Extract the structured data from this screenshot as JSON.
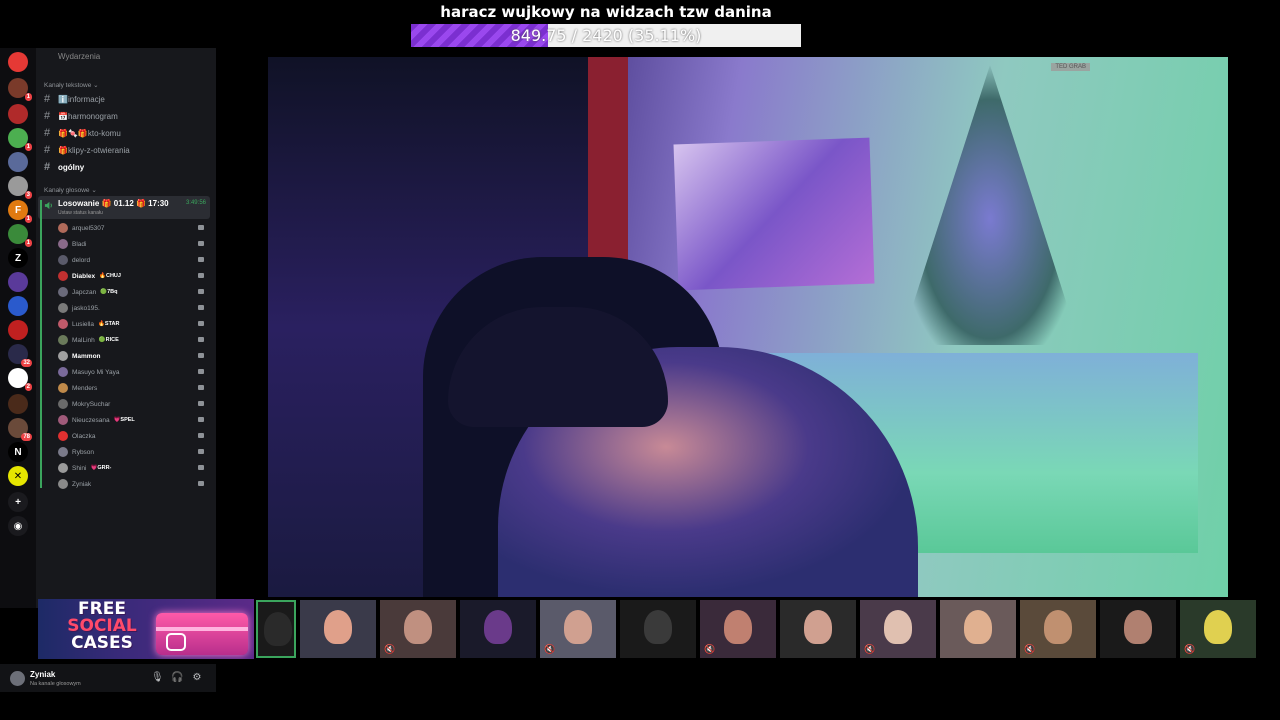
{
  "goal": {
    "title": "haracz wujkowy na widzach tzw danina",
    "progress_text": "849.75 / 2420 (35.11%)",
    "fraction": 0.3511
  },
  "rail": [
    {
      "name": "server-pokeball-icon",
      "color": "#e53935",
      "glyph": "",
      "badge": ""
    },
    {
      "name": "server-icon",
      "color": "#7a3a2a",
      "glyph": "",
      "badge": "1"
    },
    {
      "name": "server-icon",
      "color": "#b02a2a",
      "glyph": "",
      "badge": ""
    },
    {
      "name": "server-icon",
      "color": "#4caf50",
      "glyph": "",
      "badge": "1"
    },
    {
      "name": "server-icon",
      "color": "#5a6a9a",
      "glyph": "",
      "badge": ""
    },
    {
      "name": "server-icon",
      "color": "#9a9a9a",
      "glyph": "",
      "badge": "3"
    },
    {
      "name": "server-icon",
      "color": "#e07a10",
      "glyph": "F",
      "badge": "1"
    },
    {
      "name": "server-icon",
      "color": "#3a8a3a",
      "glyph": "",
      "badge": "1"
    },
    {
      "name": "server-icon",
      "color": "#000000",
      "glyph": "Z",
      "badge": ""
    },
    {
      "name": "server-icon",
      "color": "#5a3a9a",
      "glyph": "",
      "badge": ""
    },
    {
      "name": "server-icon",
      "color": "#2a5acc",
      "glyph": "",
      "badge": ""
    },
    {
      "name": "server-icon",
      "color": "#c02020",
      "glyph": "",
      "badge": ""
    },
    {
      "name": "server-icon",
      "color": "#2a2a4a",
      "glyph": "",
      "badge": "32"
    },
    {
      "name": "server-icon",
      "color": "#ffffff",
      "glyph": "",
      "badge": "2"
    },
    {
      "name": "server-icon",
      "color": "#4a2a1a",
      "glyph": "",
      "badge": ""
    },
    {
      "name": "server-icon",
      "color": "#6a4a3a",
      "glyph": "",
      "badge": "78"
    },
    {
      "name": "server-icon",
      "color": "#000000",
      "glyph": "N",
      "badge": ""
    },
    {
      "name": "server-icon",
      "color": "#e5e500",
      "glyph": "✕",
      "badge": ""
    },
    {
      "name": "add-server-icon",
      "color": "#1a1a1e",
      "glyph": "+",
      "badge": ""
    },
    {
      "name": "explore-icon",
      "color": "#1a1a1e",
      "glyph": "◉",
      "badge": ""
    }
  ],
  "sidebar": {
    "events_label": "Wydarzenia",
    "text_category": "Kanały tekstowe",
    "text_channels": [
      {
        "label": "ℹ️informacje",
        "bold": false
      },
      {
        "label": "📅harmonogram",
        "bold": false
      },
      {
        "label": "🎁🍬🎁kto-komu",
        "bold": false
      },
      {
        "label": "🎁klipy-z-otwierania",
        "bold": false
      },
      {
        "label": "ogólny",
        "bold": true
      }
    ],
    "voice_category": "Kanały głosowe",
    "voice_channel": {
      "name": "Losowanie 🎁 01.12 🎁 17:30",
      "status": "Ustaw status kanału",
      "elapsed": "3:49:56"
    },
    "members": [
      {
        "name": "arquel5307",
        "tag": "",
        "bold": false,
        "color": "#b06a5a"
      },
      {
        "name": "Bladi",
        "tag": "",
        "bold": false,
        "color": "#8a6a8a"
      },
      {
        "name": "delord",
        "tag": "",
        "bold": false,
        "color": "#5a5a6a"
      },
      {
        "name": "Diablex",
        "tag": "🔥CHUJ",
        "bold": true,
        "color": "#c03030"
      },
      {
        "name": "Japczan",
        "tag": "🟢7Bq",
        "bold": false,
        "color": "#6a6a7a"
      },
      {
        "name": "jasko195.",
        "tag": "",
        "bold": false,
        "color": "#7a7a7a"
      },
      {
        "name": "Lusiella",
        "tag": "🔥STAR",
        "bold": false,
        "color": "#c05a6a"
      },
      {
        "name": "MalLinh",
        "tag": "🟢RICE",
        "bold": false,
        "color": "#6a7a5a"
      },
      {
        "name": "Mammon",
        "tag": "",
        "bold": true,
        "color": "#a0a0a0"
      },
      {
        "name": "Masuyo Mi Yaya",
        "tag": "",
        "bold": false,
        "color": "#7a6a9a"
      },
      {
        "name": "Menders",
        "tag": "",
        "bold": false,
        "color": "#c08a4a"
      },
      {
        "name": "MokrySuchar",
        "tag": "",
        "bold": false,
        "color": "#6a6a6a"
      },
      {
        "name": "Nieuczesana",
        "tag": "💗SPEL",
        "bold": false,
        "color": "#a05a7a"
      },
      {
        "name": "Olaczka",
        "tag": "",
        "bold": false,
        "color": "#e03030"
      },
      {
        "name": "Rybson",
        "tag": "",
        "bold": false,
        "color": "#7a7a8a"
      },
      {
        "name": "Shini",
        "tag": "💗GRR-",
        "bold": false,
        "color": "#9a9a9a"
      },
      {
        "name": "Zyniak",
        "tag": "",
        "bold": false,
        "color": "#8a8a8a"
      }
    ]
  },
  "promo": {
    "line1": "FREE",
    "line2": "SOCIAL",
    "line3": "CASES"
  },
  "user_panel": {
    "name": "Zyniak",
    "status": "Na kanale głosowym"
  },
  "camera": {
    "label": "TED GRAB"
  },
  "thumbnails": [
    {
      "bg": "#1a1a1a",
      "face": "#2a2a2a",
      "active": true
    },
    {
      "bg": "#3a3a4a",
      "face": "#e0a08a",
      "active": false
    },
    {
      "bg": "#4a3a3a",
      "face": "#c09080",
      "active": false
    },
    {
      "bg": "#1a1a2a",
      "face": "#6a3a8a",
      "active": false
    },
    {
      "bg": "#5a5a6a",
      "face": "#d0a090",
      "active": false
    },
    {
      "bg": "#1a1a1a",
      "face": "#3a3a3a",
      "active": false
    },
    {
      "bg": "#3a2a3a",
      "face": "#c08070",
      "active": false
    },
    {
      "bg": "#2a2a2a",
      "face": "#d0a090",
      "active": false
    },
    {
      "bg": "#4a3a4a",
      "face": "#e0c0b0",
      "active": false
    },
    {
      "bg": "#6a5a5a",
      "face": "#e0b090",
      "active": false
    },
    {
      "bg": "#5a4a3a",
      "face": "#c09070",
      "active": false
    },
    {
      "bg": "#1a1a1a",
      "face": "#b08070",
      "active": false
    },
    {
      "bg": "#2a3a2a",
      "face": "#e0d050",
      "active": false
    }
  ]
}
